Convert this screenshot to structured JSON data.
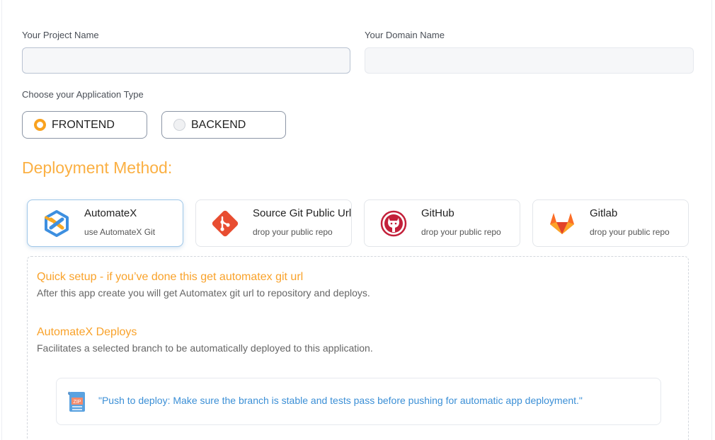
{
  "form": {
    "project_name_label": "Your Project Name",
    "project_name_value": "",
    "domain_name_label": "Your Domain Name",
    "domain_name_value": "",
    "app_type_label": "Choose your Application Type",
    "app_types": [
      {
        "label": "FRONTEND",
        "selected": true
      },
      {
        "label": "BACKEND",
        "selected": false
      }
    ]
  },
  "deployment": {
    "title": "Deployment Method:",
    "methods": [
      {
        "title": "AutomateX",
        "subtitle": "use AutomateX Git",
        "icon": "automatex-logo-icon",
        "selected": true
      },
      {
        "title": "Source Git Public Url",
        "subtitle": "drop your public repo",
        "icon": "git-logo-icon",
        "selected": false
      },
      {
        "title": "GitHub",
        "subtitle": "drop your public repo",
        "icon": "github-logo-icon",
        "selected": false
      },
      {
        "title": "Gitlab",
        "subtitle": "drop your public repo",
        "icon": "gitlab-logo-icon",
        "selected": false
      }
    ]
  },
  "info": {
    "quick_setup_heading": "Quick setup - if you’ve done this get automatex git url",
    "quick_setup_text": "After this app create you will get Automatex git url to repository and deploys.",
    "deploys_heading": "AutomateX Deploys",
    "deploys_text": "Facilitates a selected branch to be automatically deployed to this application.",
    "note_text": "\"Push to deploy: Make sure the branch is stable and tests pass before pushing for automatic app deployment.\"",
    "note_icon": "zip-file-icon",
    "note_icon_label": "ZIP"
  },
  "colors": {
    "accent_orange": "#fbb043",
    "note_blue": "#3b8fd6",
    "selected_border": "#9fc7e8"
  }
}
